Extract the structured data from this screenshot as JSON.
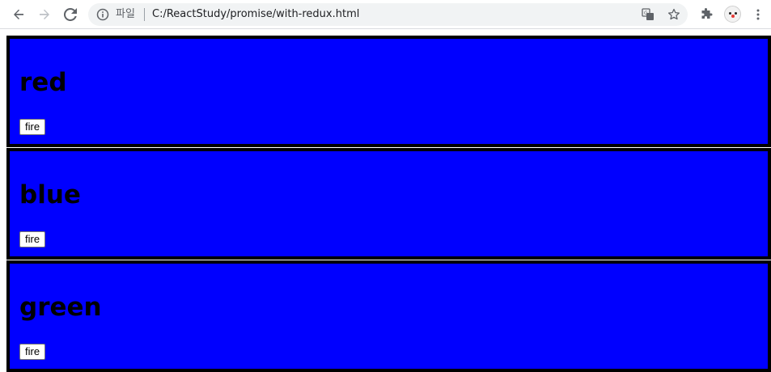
{
  "browser": {
    "scheme_label": "파일",
    "url": "C:/ReactStudy/promise/with-redux.html",
    "icons": {
      "back": "back-arrow-icon",
      "forward": "forward-arrow-icon",
      "reload": "reload-icon",
      "info": "info-icon",
      "translate": "translate-icon",
      "bookmark": "star-icon",
      "extensions": "puzzle-icon",
      "profile": "profile-avatar",
      "menu": "kebab-menu-icon"
    }
  },
  "panels": [
    {
      "title": "red",
      "button_label": "fire"
    },
    {
      "title": "blue",
      "button_label": "fire"
    },
    {
      "title": "green",
      "button_label": "fire"
    }
  ],
  "colors": {
    "panel_background": "#0000ff",
    "panel_border": "#000000"
  }
}
